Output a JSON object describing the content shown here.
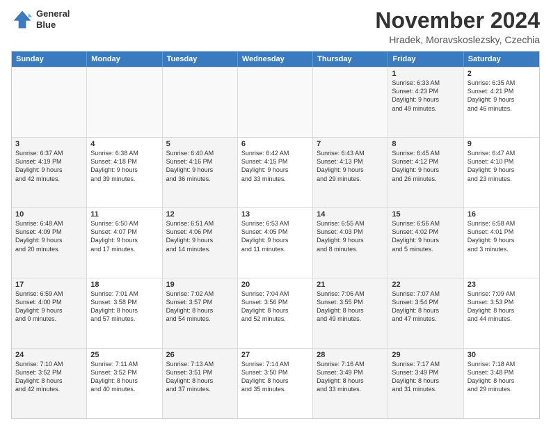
{
  "header": {
    "logo_line1": "General",
    "logo_line2": "Blue",
    "month_title": "November 2024",
    "location": "Hradek, Moravskoslezsky, Czechia"
  },
  "days_of_week": [
    "Sunday",
    "Monday",
    "Tuesday",
    "Wednesday",
    "Thursday",
    "Friday",
    "Saturday"
  ],
  "weeks": [
    [
      {
        "day": "",
        "lines": [],
        "empty": true
      },
      {
        "day": "",
        "lines": [],
        "empty": true
      },
      {
        "day": "",
        "lines": [],
        "empty": true
      },
      {
        "day": "",
        "lines": [],
        "empty": true
      },
      {
        "day": "",
        "lines": [],
        "empty": true
      },
      {
        "day": "1",
        "lines": [
          "Sunrise: 6:33 AM",
          "Sunset: 4:23 PM",
          "Daylight: 9 hours",
          "and 49 minutes."
        ],
        "shaded": true
      },
      {
        "day": "2",
        "lines": [
          "Sunrise: 6:35 AM",
          "Sunset: 4:21 PM",
          "Daylight: 9 hours",
          "and 46 minutes."
        ],
        "shaded": false
      }
    ],
    [
      {
        "day": "3",
        "lines": [
          "Sunrise: 6:37 AM",
          "Sunset: 4:19 PM",
          "Daylight: 9 hours",
          "and 42 minutes."
        ],
        "shaded": true
      },
      {
        "day": "4",
        "lines": [
          "Sunrise: 6:38 AM",
          "Sunset: 4:18 PM",
          "Daylight: 9 hours",
          "and 39 minutes."
        ],
        "shaded": false
      },
      {
        "day": "5",
        "lines": [
          "Sunrise: 6:40 AM",
          "Sunset: 4:16 PM",
          "Daylight: 9 hours",
          "and 36 minutes."
        ],
        "shaded": true
      },
      {
        "day": "6",
        "lines": [
          "Sunrise: 6:42 AM",
          "Sunset: 4:15 PM",
          "Daylight: 9 hours",
          "and 33 minutes."
        ],
        "shaded": false
      },
      {
        "day": "7",
        "lines": [
          "Sunrise: 6:43 AM",
          "Sunset: 4:13 PM",
          "Daylight: 9 hours",
          "and 29 minutes."
        ],
        "shaded": true
      },
      {
        "day": "8",
        "lines": [
          "Sunrise: 6:45 AM",
          "Sunset: 4:12 PM",
          "Daylight: 9 hours",
          "and 26 minutes."
        ],
        "shaded": true
      },
      {
        "day": "9",
        "lines": [
          "Sunrise: 6:47 AM",
          "Sunset: 4:10 PM",
          "Daylight: 9 hours",
          "and 23 minutes."
        ],
        "shaded": false
      }
    ],
    [
      {
        "day": "10",
        "lines": [
          "Sunrise: 6:48 AM",
          "Sunset: 4:09 PM",
          "Daylight: 9 hours",
          "and 20 minutes."
        ],
        "shaded": true
      },
      {
        "day": "11",
        "lines": [
          "Sunrise: 6:50 AM",
          "Sunset: 4:07 PM",
          "Daylight: 9 hours",
          "and 17 minutes."
        ],
        "shaded": false
      },
      {
        "day": "12",
        "lines": [
          "Sunrise: 6:51 AM",
          "Sunset: 4:06 PM",
          "Daylight: 9 hours",
          "and 14 minutes."
        ],
        "shaded": true
      },
      {
        "day": "13",
        "lines": [
          "Sunrise: 6:53 AM",
          "Sunset: 4:05 PM",
          "Daylight: 9 hours",
          "and 11 minutes."
        ],
        "shaded": false
      },
      {
        "day": "14",
        "lines": [
          "Sunrise: 6:55 AM",
          "Sunset: 4:03 PM",
          "Daylight: 9 hours",
          "and 8 minutes."
        ],
        "shaded": true
      },
      {
        "day": "15",
        "lines": [
          "Sunrise: 6:56 AM",
          "Sunset: 4:02 PM",
          "Daylight: 9 hours",
          "and 5 minutes."
        ],
        "shaded": true
      },
      {
        "day": "16",
        "lines": [
          "Sunrise: 6:58 AM",
          "Sunset: 4:01 PM",
          "Daylight: 9 hours",
          "and 3 minutes."
        ],
        "shaded": false
      }
    ],
    [
      {
        "day": "17",
        "lines": [
          "Sunrise: 6:59 AM",
          "Sunset: 4:00 PM",
          "Daylight: 9 hours",
          "and 0 minutes."
        ],
        "shaded": true
      },
      {
        "day": "18",
        "lines": [
          "Sunrise: 7:01 AM",
          "Sunset: 3:58 PM",
          "Daylight: 8 hours",
          "and 57 minutes."
        ],
        "shaded": false
      },
      {
        "day": "19",
        "lines": [
          "Sunrise: 7:02 AM",
          "Sunset: 3:57 PM",
          "Daylight: 8 hours",
          "and 54 minutes."
        ],
        "shaded": true
      },
      {
        "day": "20",
        "lines": [
          "Sunrise: 7:04 AM",
          "Sunset: 3:56 PM",
          "Daylight: 8 hours",
          "and 52 minutes."
        ],
        "shaded": false
      },
      {
        "day": "21",
        "lines": [
          "Sunrise: 7:06 AM",
          "Sunset: 3:55 PM",
          "Daylight: 8 hours",
          "and 49 minutes."
        ],
        "shaded": true
      },
      {
        "day": "22",
        "lines": [
          "Sunrise: 7:07 AM",
          "Sunset: 3:54 PM",
          "Daylight: 8 hours",
          "and 47 minutes."
        ],
        "shaded": true
      },
      {
        "day": "23",
        "lines": [
          "Sunrise: 7:09 AM",
          "Sunset: 3:53 PM",
          "Daylight: 8 hours",
          "and 44 minutes."
        ],
        "shaded": false
      }
    ],
    [
      {
        "day": "24",
        "lines": [
          "Sunrise: 7:10 AM",
          "Sunset: 3:52 PM",
          "Daylight: 8 hours",
          "and 42 minutes."
        ],
        "shaded": true
      },
      {
        "day": "25",
        "lines": [
          "Sunrise: 7:11 AM",
          "Sunset: 3:52 PM",
          "Daylight: 8 hours",
          "and 40 minutes."
        ],
        "shaded": false
      },
      {
        "day": "26",
        "lines": [
          "Sunrise: 7:13 AM",
          "Sunset: 3:51 PM",
          "Daylight: 8 hours",
          "and 37 minutes."
        ],
        "shaded": true
      },
      {
        "day": "27",
        "lines": [
          "Sunrise: 7:14 AM",
          "Sunset: 3:50 PM",
          "Daylight: 8 hours",
          "and 35 minutes."
        ],
        "shaded": false
      },
      {
        "day": "28",
        "lines": [
          "Sunrise: 7:16 AM",
          "Sunset: 3:49 PM",
          "Daylight: 8 hours",
          "and 33 minutes."
        ],
        "shaded": true
      },
      {
        "day": "29",
        "lines": [
          "Sunrise: 7:17 AM",
          "Sunset: 3:49 PM",
          "Daylight: 8 hours",
          "and 31 minutes."
        ],
        "shaded": true
      },
      {
        "day": "30",
        "lines": [
          "Sunrise: 7:18 AM",
          "Sunset: 3:48 PM",
          "Daylight: 8 hours",
          "and 29 minutes."
        ],
        "shaded": false
      }
    ]
  ]
}
